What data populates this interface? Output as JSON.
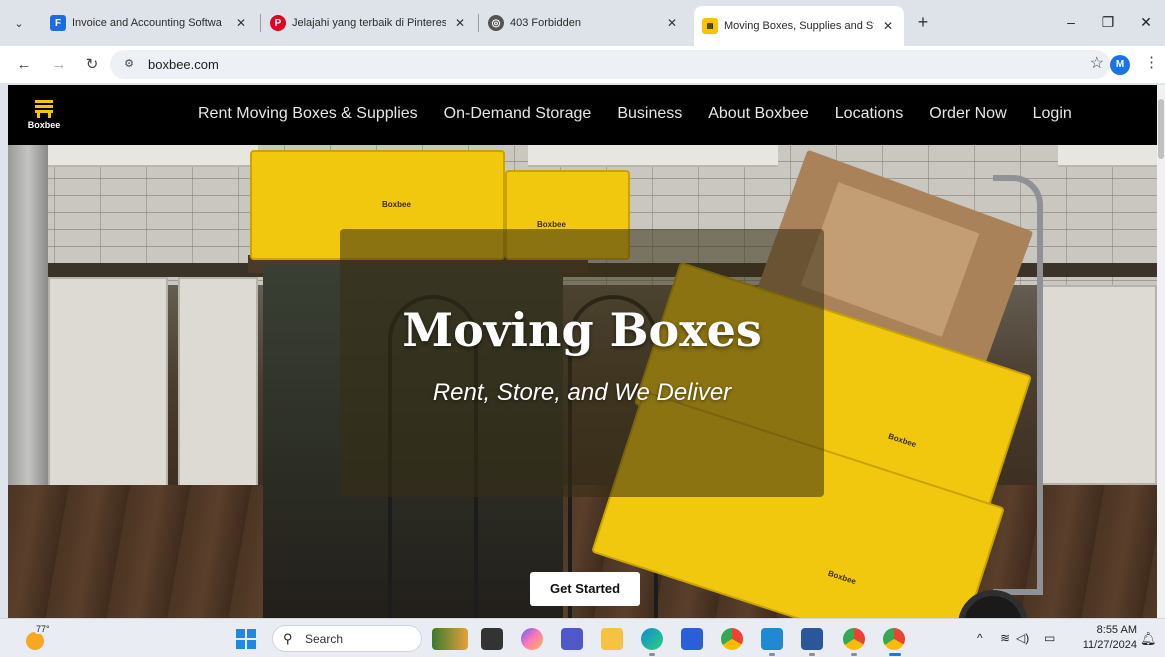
{
  "browser": {
    "tabs": [
      {
        "title": "Invoice and Accounting Softwa",
        "favicon": "F",
        "favicon_color": "#1d6ae5"
      },
      {
        "title": "Jelajahi yang terbaik di Pinteres",
        "favicon": "P",
        "favicon_color": "#e60023"
      },
      {
        "title": "403 Forbidden",
        "favicon": "globe",
        "favicon_color": "#555555"
      },
      {
        "title": "Moving Boxes, Supplies and Sto",
        "favicon": "boxbee",
        "favicon_color": "#f7c500"
      }
    ],
    "new_tab": "+",
    "window_controls": {
      "minimize": "–",
      "restore": "❐",
      "close": "✕"
    },
    "address": "boxbee.com",
    "profile_initial": "M"
  },
  "site": {
    "logo_text": "Boxbee",
    "nav": [
      "Rent Moving Boxes & Supplies",
      "On-Demand Storage",
      "Business",
      "About Boxbee",
      "Locations",
      "Order Now",
      "Login"
    ],
    "hero_title": "Moving Boxes",
    "hero_subtitle": "Rent, Store, and We Deliver",
    "cta": "Get Started",
    "crate_label": "Boxbee",
    "brand_color": "#f7c500"
  },
  "taskbar": {
    "weather_temp": "77°",
    "search_placeholder": "Search",
    "time": "8:55 AM",
    "date": "11/27/2024"
  }
}
